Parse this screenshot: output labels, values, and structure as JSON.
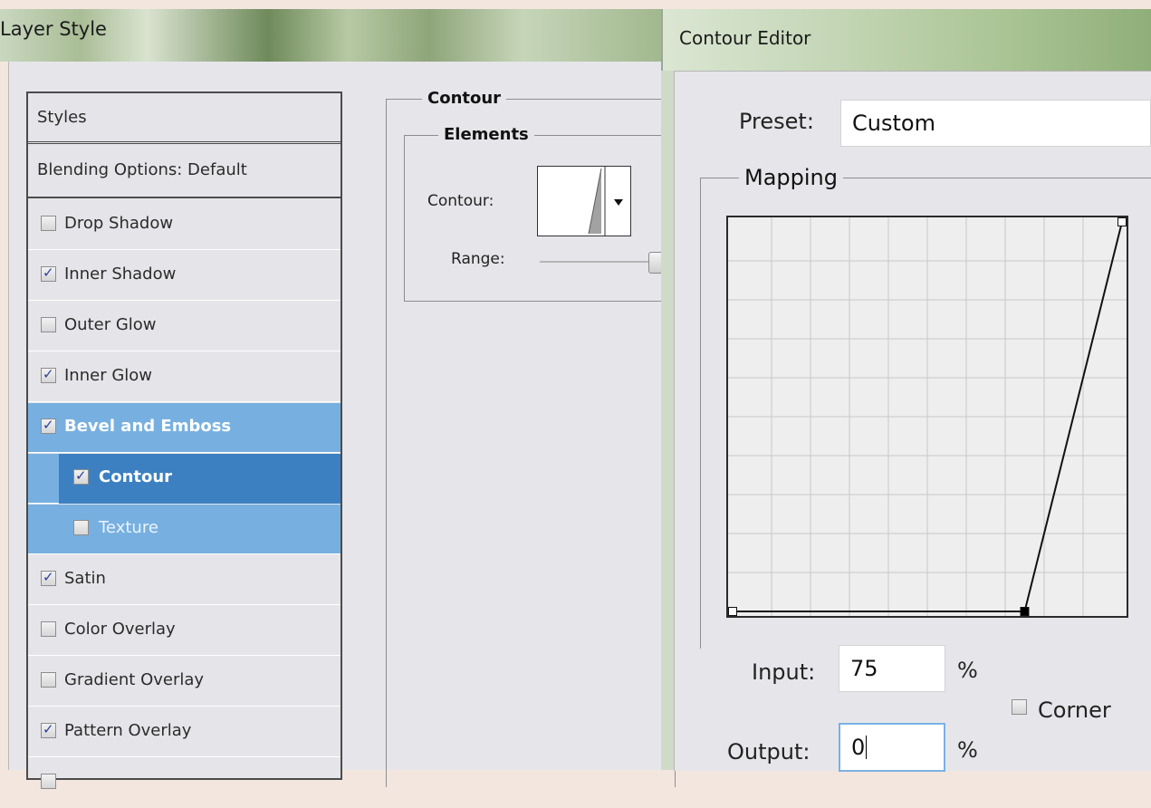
{
  "layer_style": {
    "title": "Layer Style",
    "styles_header": "Styles",
    "blending_options": "Blending Options: Default",
    "items": [
      {
        "label": "Drop Shadow",
        "checked": false
      },
      {
        "label": "Inner Shadow",
        "checked": true
      },
      {
        "label": "Outer Glow",
        "checked": false
      },
      {
        "label": "Inner Glow",
        "checked": true
      },
      {
        "label": "Bevel and Emboss",
        "checked": true,
        "selected": true
      },
      {
        "label": "Contour",
        "checked": true,
        "selected": true,
        "sub": true
      },
      {
        "label": "Texture",
        "checked": false,
        "sub": true
      },
      {
        "label": "Satin",
        "checked": true
      },
      {
        "label": "Color Overlay",
        "checked": false
      },
      {
        "label": "Gradient Overlay",
        "checked": false
      },
      {
        "label": "Pattern Overlay",
        "checked": true
      }
    ],
    "contour_group": {
      "title": "Contour",
      "elements_title": "Elements",
      "contour_label": "Contour:",
      "range_label": "Range:"
    }
  },
  "contour_editor": {
    "title": "Contour Editor",
    "preset_label": "Preset:",
    "preset_value": "Custom",
    "mapping_title": "Mapping",
    "input_label": "Input:",
    "input_value": "75",
    "input_unit": "%",
    "output_label": "Output:",
    "output_value": "0",
    "output_unit": "%",
    "corner_label": "Corner",
    "corner_checked": false,
    "curve_points": [
      {
        "input": 0,
        "output": 0
      },
      {
        "input": 75,
        "output": 0
      },
      {
        "input": 100,
        "output": 100
      }
    ]
  },
  "colors": {
    "selection_light": "#77b0e0",
    "selection_dark": "#3c80c2",
    "checkmark": "#2b3f9b"
  }
}
